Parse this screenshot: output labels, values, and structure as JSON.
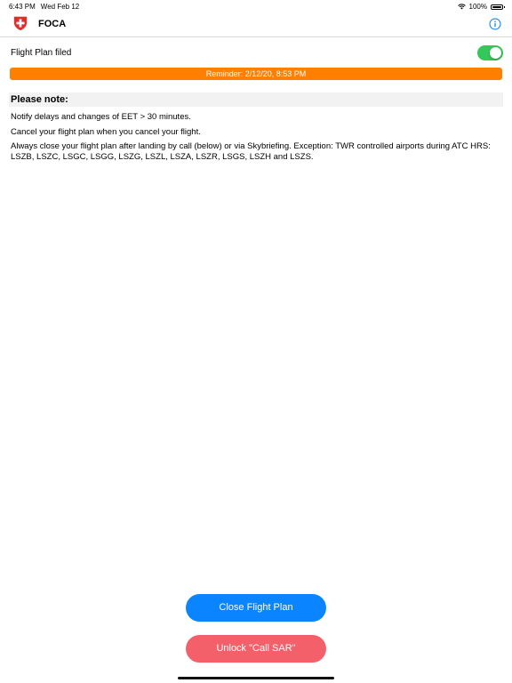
{
  "status_bar": {
    "time": "6:43 PM",
    "date": "Wed Feb 12",
    "battery_percent": "100%"
  },
  "nav": {
    "title": "FOCA",
    "logo_icon": "swiss-cross-icon",
    "info_icon": "info-icon"
  },
  "flight_plan": {
    "label": "Flight Plan filed",
    "toggle_on": true
  },
  "reminder": {
    "text": "Reminder: 2/12/20, 8:53 PM"
  },
  "note": {
    "title": "Please note:",
    "line1": "Notify delays and changes of EET > 30 minutes.",
    "line2": "Cancel your flight plan when you cancel your flight.",
    "line3": "Always close your flight plan after landing by call (below) or via Skybriefing. Exception: TWR controlled airports during ATC HRS: LSZB, LSZC, LSGC, LSGG, LSZG, LSZL, LSZA, LSZR, LSGS, LSZH and LSZS."
  },
  "buttons": {
    "close_label": "Close Flight Plan",
    "sar_label": "Unlock \"Call SAR\""
  },
  "colors": {
    "accent_blue": "#0a84ff",
    "reminder_orange": "#ff8000",
    "toggle_green": "#34c759",
    "sar_red": "#f4606a"
  }
}
